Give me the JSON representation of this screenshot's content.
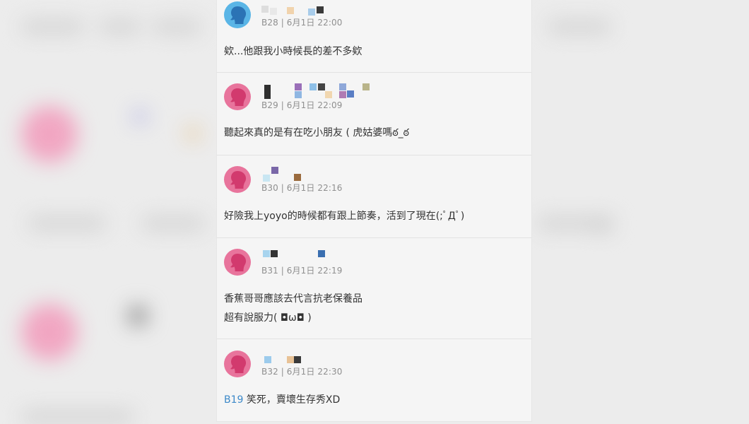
{
  "comments": [
    {
      "floor": "B28",
      "time": "6月1日 22:00",
      "avatar": "blue",
      "lines": [
        "欸...他跟我小時候長的差不多欸"
      ]
    },
    {
      "floor": "B29",
      "time": "6月1日 22:09",
      "avatar": "pink",
      "lines": [
        "聽起來真的是有在吃小朋友 ( 虎姑婆嗎ఠ_ఠ"
      ]
    },
    {
      "floor": "B30",
      "time": "6月1日 22:16",
      "avatar": "pink",
      "lines": [
        "好險我上yoyo的時候都有跟上節奏，活到了現在(;ﾟДﾟ)"
      ]
    },
    {
      "floor": "B31",
      "time": "6月1日 22:19",
      "avatar": "pink",
      "lines": [
        "香蕉哥哥應該去代言抗老保養品",
        "超有說服力( ◘ω◘ )"
      ]
    },
    {
      "floor": "B32",
      "time": "6月1日 22:30",
      "avatar": "pink",
      "reply_to": "B19",
      "lines": [
        "笑死，賣壞生存秀XD"
      ]
    }
  ],
  "separator": " | ",
  "colors": {
    "panel_bg": "#f5f5f5",
    "avatar_blue": "#5ab5e6",
    "avatar_pink": "#e8749c",
    "meta_text": "#8f8f8f",
    "link": "#3c89c9"
  },
  "icons": {
    "avatar": "user-silhouette-icon"
  }
}
